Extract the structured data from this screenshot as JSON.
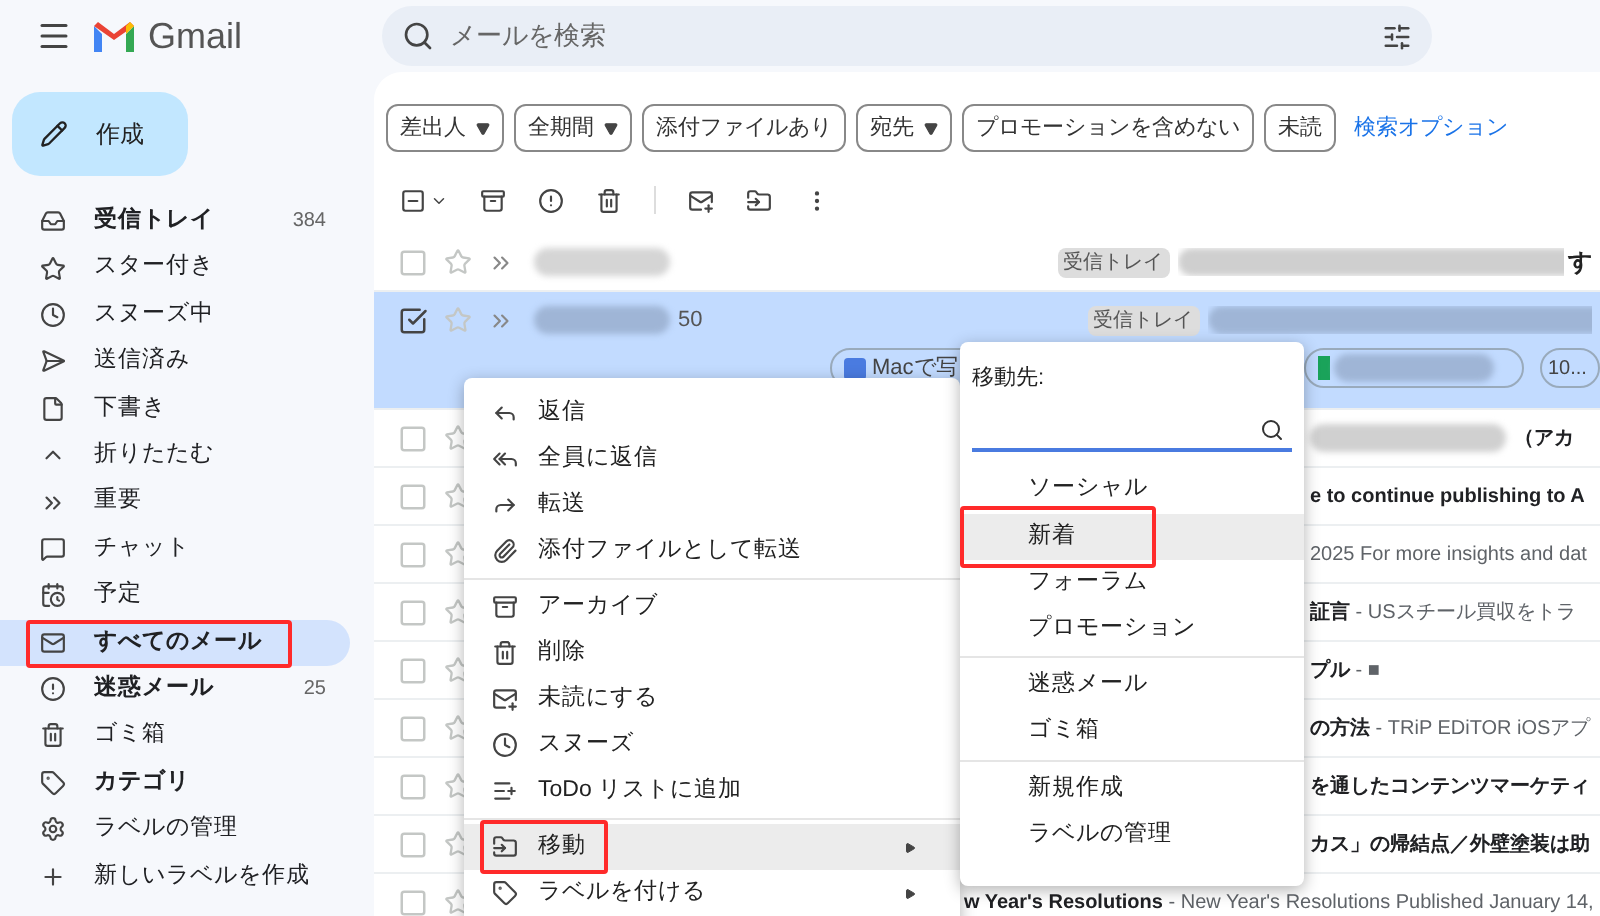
{
  "app": {
    "name": "Gmail"
  },
  "search": {
    "placeholder": "メールを検索"
  },
  "compose": {
    "label": "作成"
  },
  "sidebar": {
    "items": [
      {
        "label": "受信トレイ",
        "count": "384",
        "bold": true,
        "selected": false,
        "annotated": false
      },
      {
        "label": "スター付き",
        "bold": false,
        "selected": false,
        "annotated": false
      },
      {
        "label": "スヌーズ中",
        "bold": false,
        "selected": false,
        "annotated": false
      },
      {
        "label": "送信済み",
        "bold": false,
        "selected": false,
        "annotated": false
      },
      {
        "label": "下書き",
        "bold": false,
        "selected": false,
        "annotated": false
      },
      {
        "label": "折りたたむ",
        "bold": false,
        "selected": false,
        "annotated": false
      },
      {
        "label": "重要",
        "bold": false,
        "selected": false,
        "annotated": false
      },
      {
        "label": "チャット",
        "bold": false,
        "selected": false,
        "annotated": false
      },
      {
        "label": "予定",
        "bold": false,
        "selected": false,
        "annotated": false
      },
      {
        "label": "すべてのメール",
        "bold": true,
        "selected": true,
        "annotated": true
      },
      {
        "label": "迷惑メール",
        "count": "25",
        "bold": true,
        "selected": false,
        "annotated": false
      },
      {
        "label": "ゴミ箱",
        "bold": false,
        "selected": false,
        "annotated": false
      },
      {
        "label": "カテゴリ",
        "bold": true,
        "selected": false,
        "annotated": false
      },
      {
        "label": "ラベルの管理",
        "bold": false,
        "selected": false,
        "annotated": false
      },
      {
        "label": "新しいラベルを作成",
        "bold": false,
        "selected": false,
        "annotated": false
      }
    ]
  },
  "filters": {
    "chips": [
      {
        "label": "差出人",
        "dropdown": true
      },
      {
        "label": "全期間",
        "dropdown": true
      },
      {
        "label": "添付ファイルあり",
        "dropdown": false
      },
      {
        "label": "宛先",
        "dropdown": true
      },
      {
        "label": "プロモーションを含めない",
        "dropdown": false
      },
      {
        "label": "未読",
        "dropdown": false
      }
    ],
    "link": "検索オプション"
  },
  "toolbar": {
    "select_all": {
      "indeterminate": true
    }
  },
  "mail_list": {
    "rows": [
      {
        "kind": "full",
        "checked": false,
        "tag": "受信トレイ",
        "tail": "す"
      },
      {
        "kind": "full",
        "checked": true,
        "count": "50",
        "tag": "受信トレイ",
        "attachments": [
          "Macで写",
          "10..."
        ]
      },
      {
        "kind": "covered",
        "checked": false,
        "redacted": true,
        "subject": "（アカ"
      },
      {
        "kind": "covered",
        "checked": false,
        "subject": "e to continue publishing to A"
      },
      {
        "kind": "covered",
        "checked": false,
        "preview": "2025 For more insights and dat"
      },
      {
        "kind": "covered",
        "checked": false,
        "subject": "証言",
        "preview": "- USスチール買収をトラ"
      },
      {
        "kind": "covered",
        "checked": false,
        "subject": "プル",
        "preview": "- ■"
      },
      {
        "kind": "covered",
        "checked": false,
        "subject": "の方法",
        "preview": "- TRiP EDiTOR iOSアプ"
      },
      {
        "kind": "covered",
        "checked": false,
        "subject": "を通したコンテンツマーケティ"
      },
      {
        "kind": "covered",
        "checked": false,
        "subject": "カス」の帰結点／外壁塗装は助"
      },
      {
        "kind": "partly_covered",
        "checked": false,
        "subject": "w Year's Resolutions",
        "preview": "- New Year's Resolutions Published January 14,"
      }
    ]
  },
  "context_menu": {
    "groups": [
      [
        {
          "label": "返信",
          "submenu": false,
          "selected": false,
          "annotated": false
        },
        {
          "label": "全員に返信",
          "submenu": false,
          "selected": false,
          "annotated": false
        },
        {
          "label": "転送",
          "submenu": false,
          "selected": false,
          "annotated": false
        },
        {
          "label": "添付ファイルとして転送",
          "submenu": false,
          "selected": false,
          "annotated": false
        }
      ],
      [
        {
          "label": "アーカイブ",
          "submenu": false,
          "selected": false,
          "annotated": false
        },
        {
          "label": "削除",
          "submenu": false,
          "selected": false,
          "annotated": false
        },
        {
          "label": "未読にする",
          "submenu": false,
          "selected": false,
          "annotated": false
        },
        {
          "label": "スヌーズ",
          "submenu": false,
          "selected": false,
          "annotated": false
        },
        {
          "label": "ToDo リストに追加",
          "submenu": false,
          "selected": false,
          "annotated": false
        }
      ],
      [
        {
          "label": "移動",
          "submenu": true,
          "selected": true,
          "annotated": true
        },
        {
          "label": "ラベルを付ける",
          "submenu": true,
          "selected": false,
          "annotated": false
        }
      ]
    ]
  },
  "move_menu": {
    "title": "移動先:",
    "groups": [
      [
        {
          "label": "ソーシャル",
          "selected": false,
          "annotated": false
        },
        {
          "label": "新着",
          "selected": true,
          "annotated": true
        },
        {
          "label": "フォーラム",
          "selected": false,
          "annotated": false
        },
        {
          "label": "プロモーション",
          "selected": false,
          "annotated": false
        }
      ],
      [
        {
          "label": "迷惑メール",
          "selected": false,
          "annotated": false
        },
        {
          "label": "ゴミ箱",
          "selected": false,
          "annotated": false
        }
      ],
      [
        {
          "label": "新規作成",
          "selected": false,
          "annotated": false
        },
        {
          "label": "ラベルの管理",
          "selected": false,
          "annotated": false
        }
      ]
    ]
  }
}
